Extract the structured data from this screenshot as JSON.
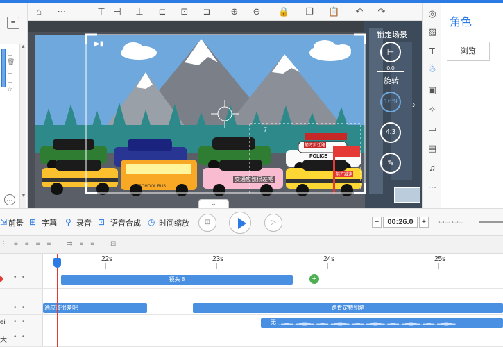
{
  "toolbar": {
    "icons": [
      "home-icon",
      "more-icon",
      "align-top-icon",
      "align-middle-icon",
      "align-bottom-icon",
      "align-left-icon",
      "align-center-icon",
      "align-right-icon",
      "zoom-in-icon",
      "zoom-out-icon",
      "lock-icon",
      "copy-icon",
      "paste-icon",
      "undo-icon",
      "redo-icon"
    ]
  },
  "stage": {
    "camera_count": "7",
    "badge_label": "交通应该很差吧",
    "police_sign": "前方拆迁路",
    "police_text": "POLICE",
    "warning_sign": "前方减速",
    "bus_text": "SCHOOL BUS"
  },
  "camera_controls": {
    "lock_scene_label": "锁定场景",
    "rotation_value": "0.0",
    "rotate_label": "旋转",
    "ratio_169": "16:9",
    "ratio_43": "4:3"
  },
  "right_panel": {
    "title": "角色",
    "browse_label": "浏览"
  },
  "control_bar": {
    "foreground_label": "前景",
    "subtitle_label": "字幕",
    "record_label": "录音",
    "tts_label": "语音合成",
    "time_scale_label": "时间缩放",
    "time_value": "00:26.0",
    "minus": "−",
    "plus": "+"
  },
  "timeline": {
    "ruler_labels": [
      "22s",
      "23s",
      "24s",
      "25s"
    ],
    "track1_clip": "镜头 8",
    "subtitle_clip1": "通应该很差吧",
    "subtitle_clip2": "路肯定特别堵",
    "voice_clip": "无",
    "row_labels": [
      "ei",
      "大"
    ]
  }
}
